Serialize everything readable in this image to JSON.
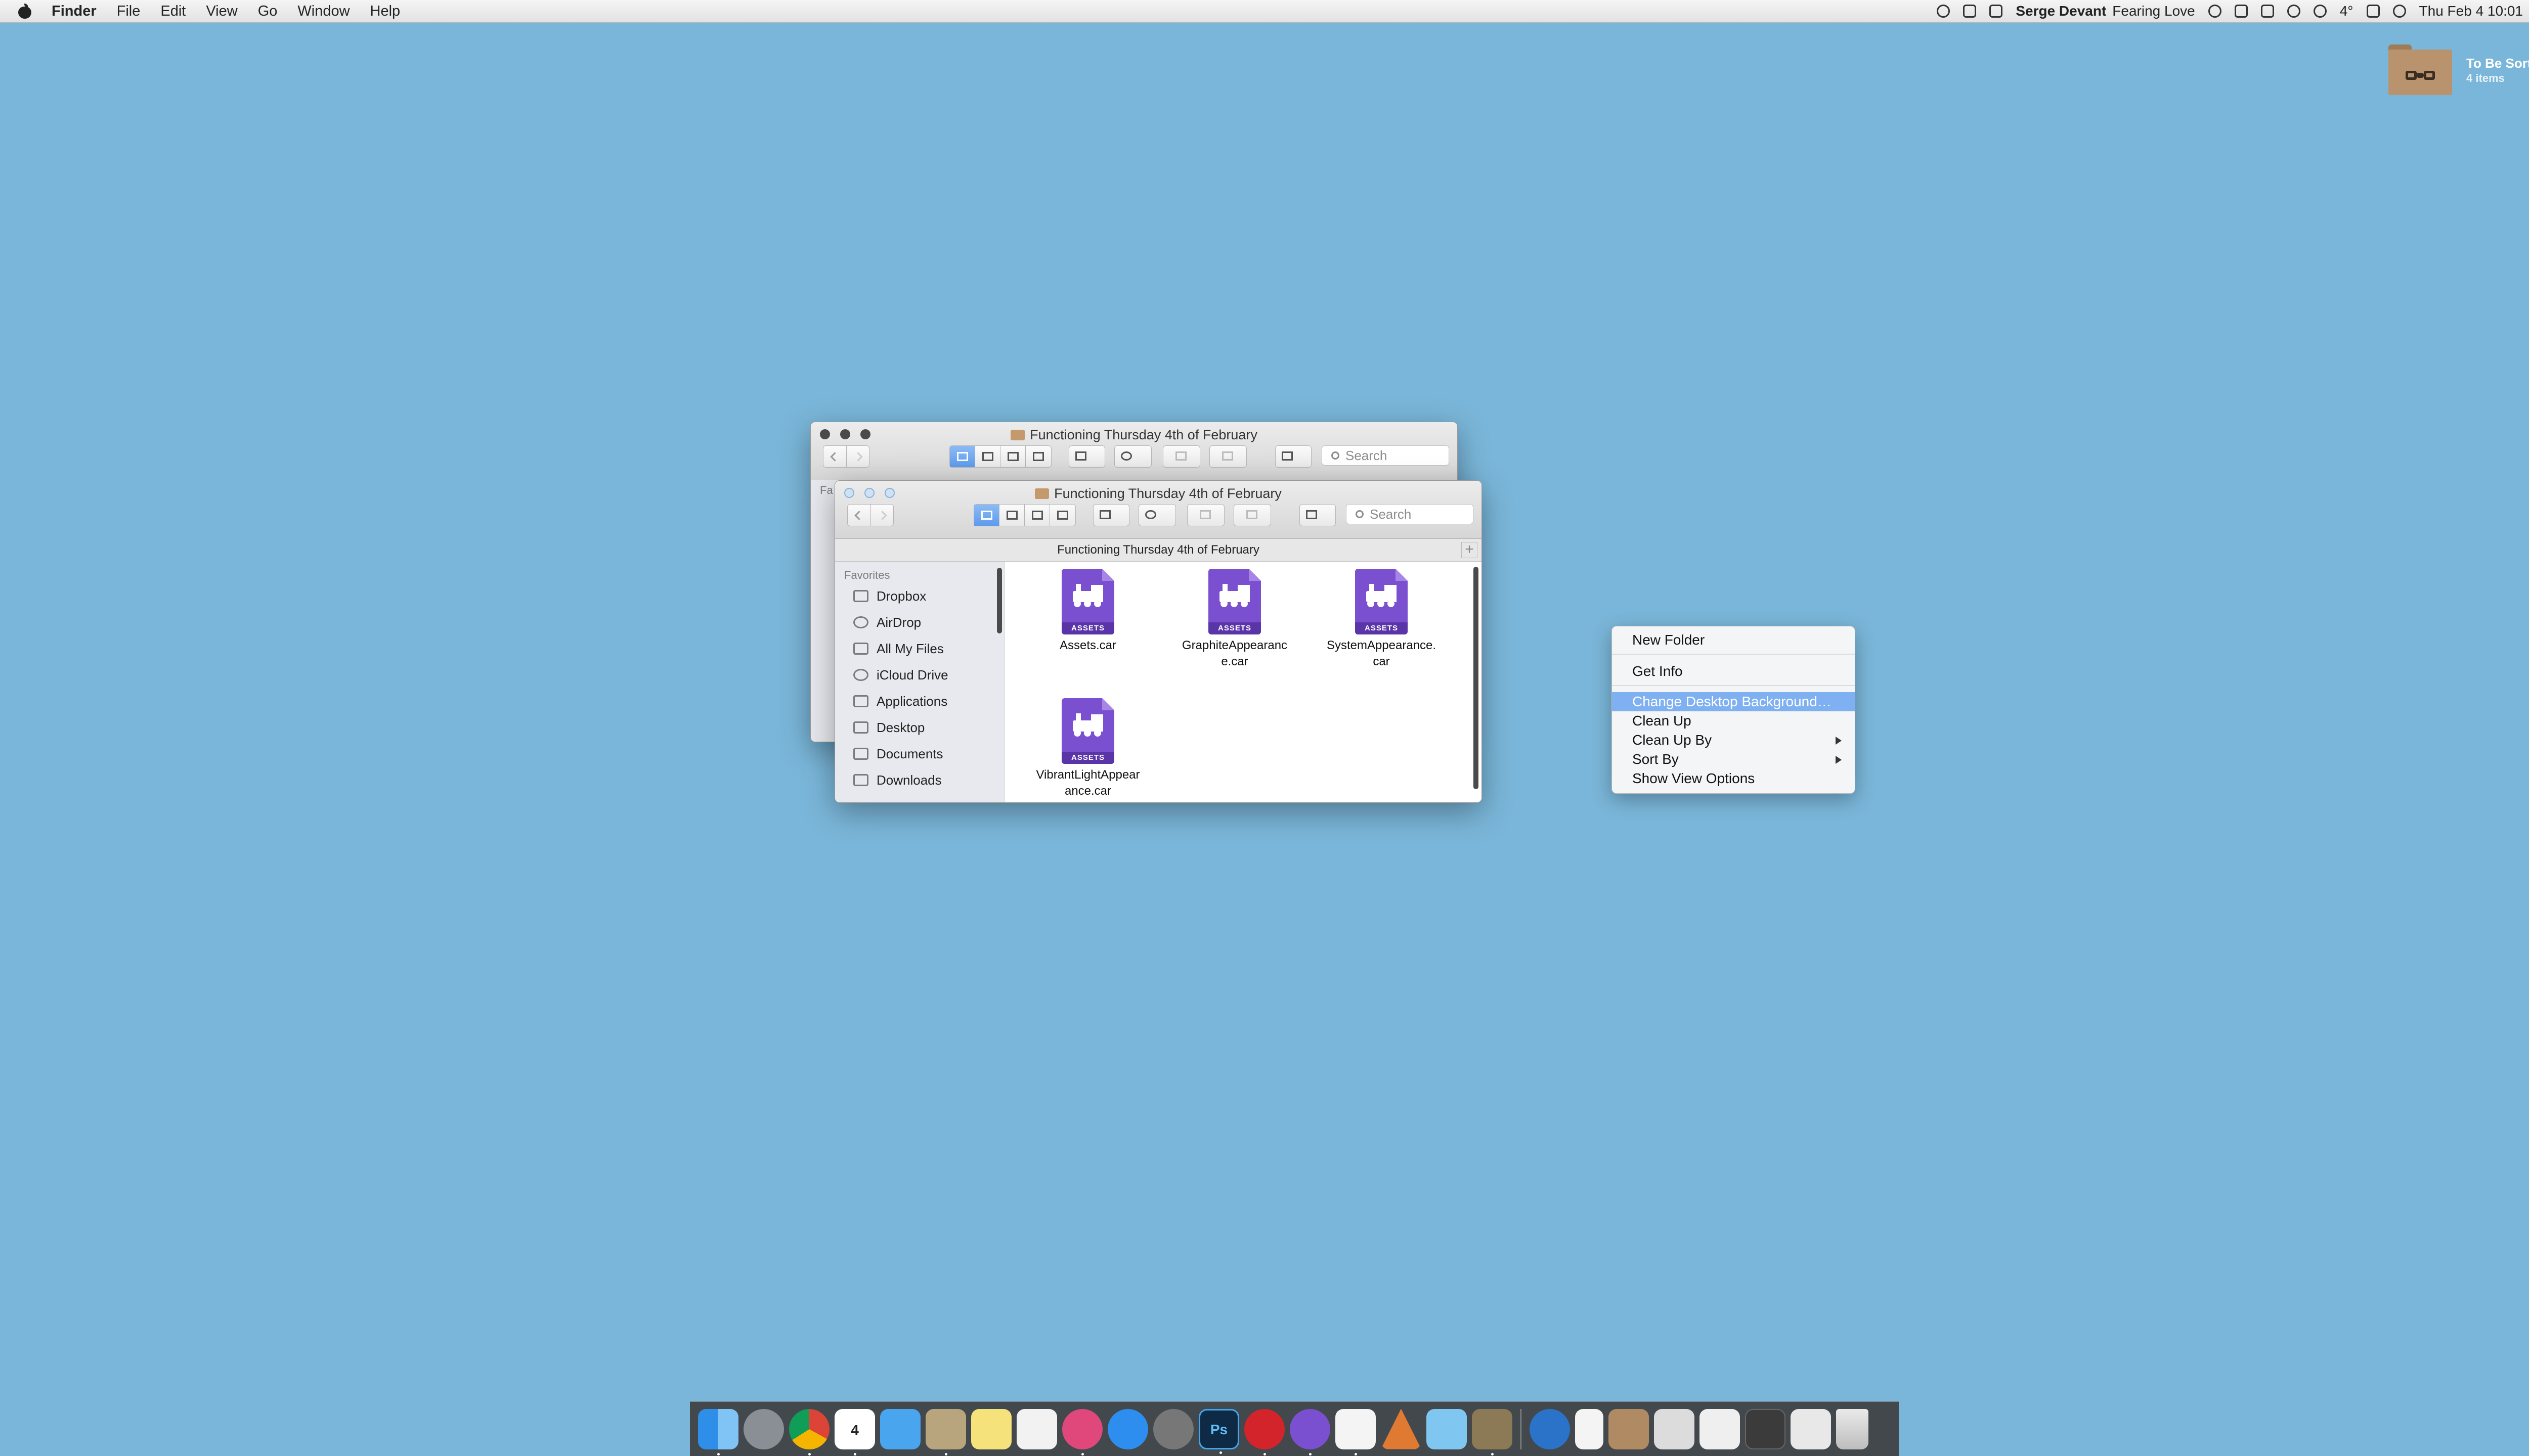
{
  "menubar": {
    "app_name": "Finder",
    "items": [
      "File",
      "Edit",
      "View",
      "Go",
      "Window",
      "Help"
    ],
    "status": {
      "now_playing_artist": "Serge Devant",
      "now_playing_track": "Fearing Love",
      "weather": "4°",
      "datetime": "Thu Feb 4  10:01"
    }
  },
  "desktop": {
    "folder_name": "To Be Sorted",
    "folder_count": "4 items",
    "background_color": "#7ab6d9"
  },
  "back_window": {
    "title": "Functioning Thursday 4th of February",
    "search_placeholder": "Search",
    "sidebar_partial": "Fa"
  },
  "front_window": {
    "title": "Functioning Thursday 4th of February",
    "search_placeholder": "Search",
    "path_title": "Functioning Thursday 4th of February",
    "sidebar_heading": "Favorites",
    "sidebar_items": [
      "Dropbox",
      "AirDrop",
      "All My Files",
      "iCloud Drive",
      "Applications",
      "Desktop",
      "Documents",
      "Downloads"
    ],
    "files": [
      {
        "line1": "Assets.car",
        "line2": ""
      },
      {
        "line1": "GraphiteAppearanc",
        "line2": "e.car"
      },
      {
        "line1": "SystemAppearance.",
        "line2": "car"
      },
      {
        "line1": "VibrantLightAppear",
        "line2": "ance.car"
      }
    ],
    "asset_badge": "ASSETS"
  },
  "context_menu": {
    "items": [
      "New Folder",
      "Get Info",
      "Change Desktop Background…",
      "Clean Up",
      "Clean Up By",
      "Sort By",
      "Show View Options"
    ],
    "highlighted_index": 2,
    "highlight_color": "#7fb1f2"
  },
  "dock": {
    "icons": [
      "finder-icon",
      "launchpad-icon",
      "chrome-icon",
      "calendar-icon",
      "mail-icon",
      "archive-icon",
      "notes-icon",
      "reminders-icon",
      "itunes-icon",
      "app-store-icon",
      "system-preferences-icon",
      "photoshop-icon",
      "scrobbler-icon",
      "asset-catalog-icon",
      "sketch-icon",
      "vector-icon",
      "preview-icon",
      "automator-icon",
      "onepassword-icon",
      "document-icon",
      "downloads-stack-icon",
      "screenshot-stack-icon",
      "documents-stack-icon",
      "folder-stack-icon",
      "trash-icon"
    ],
    "calendar_day": "4",
    "photoshop_label": "Ps"
  }
}
